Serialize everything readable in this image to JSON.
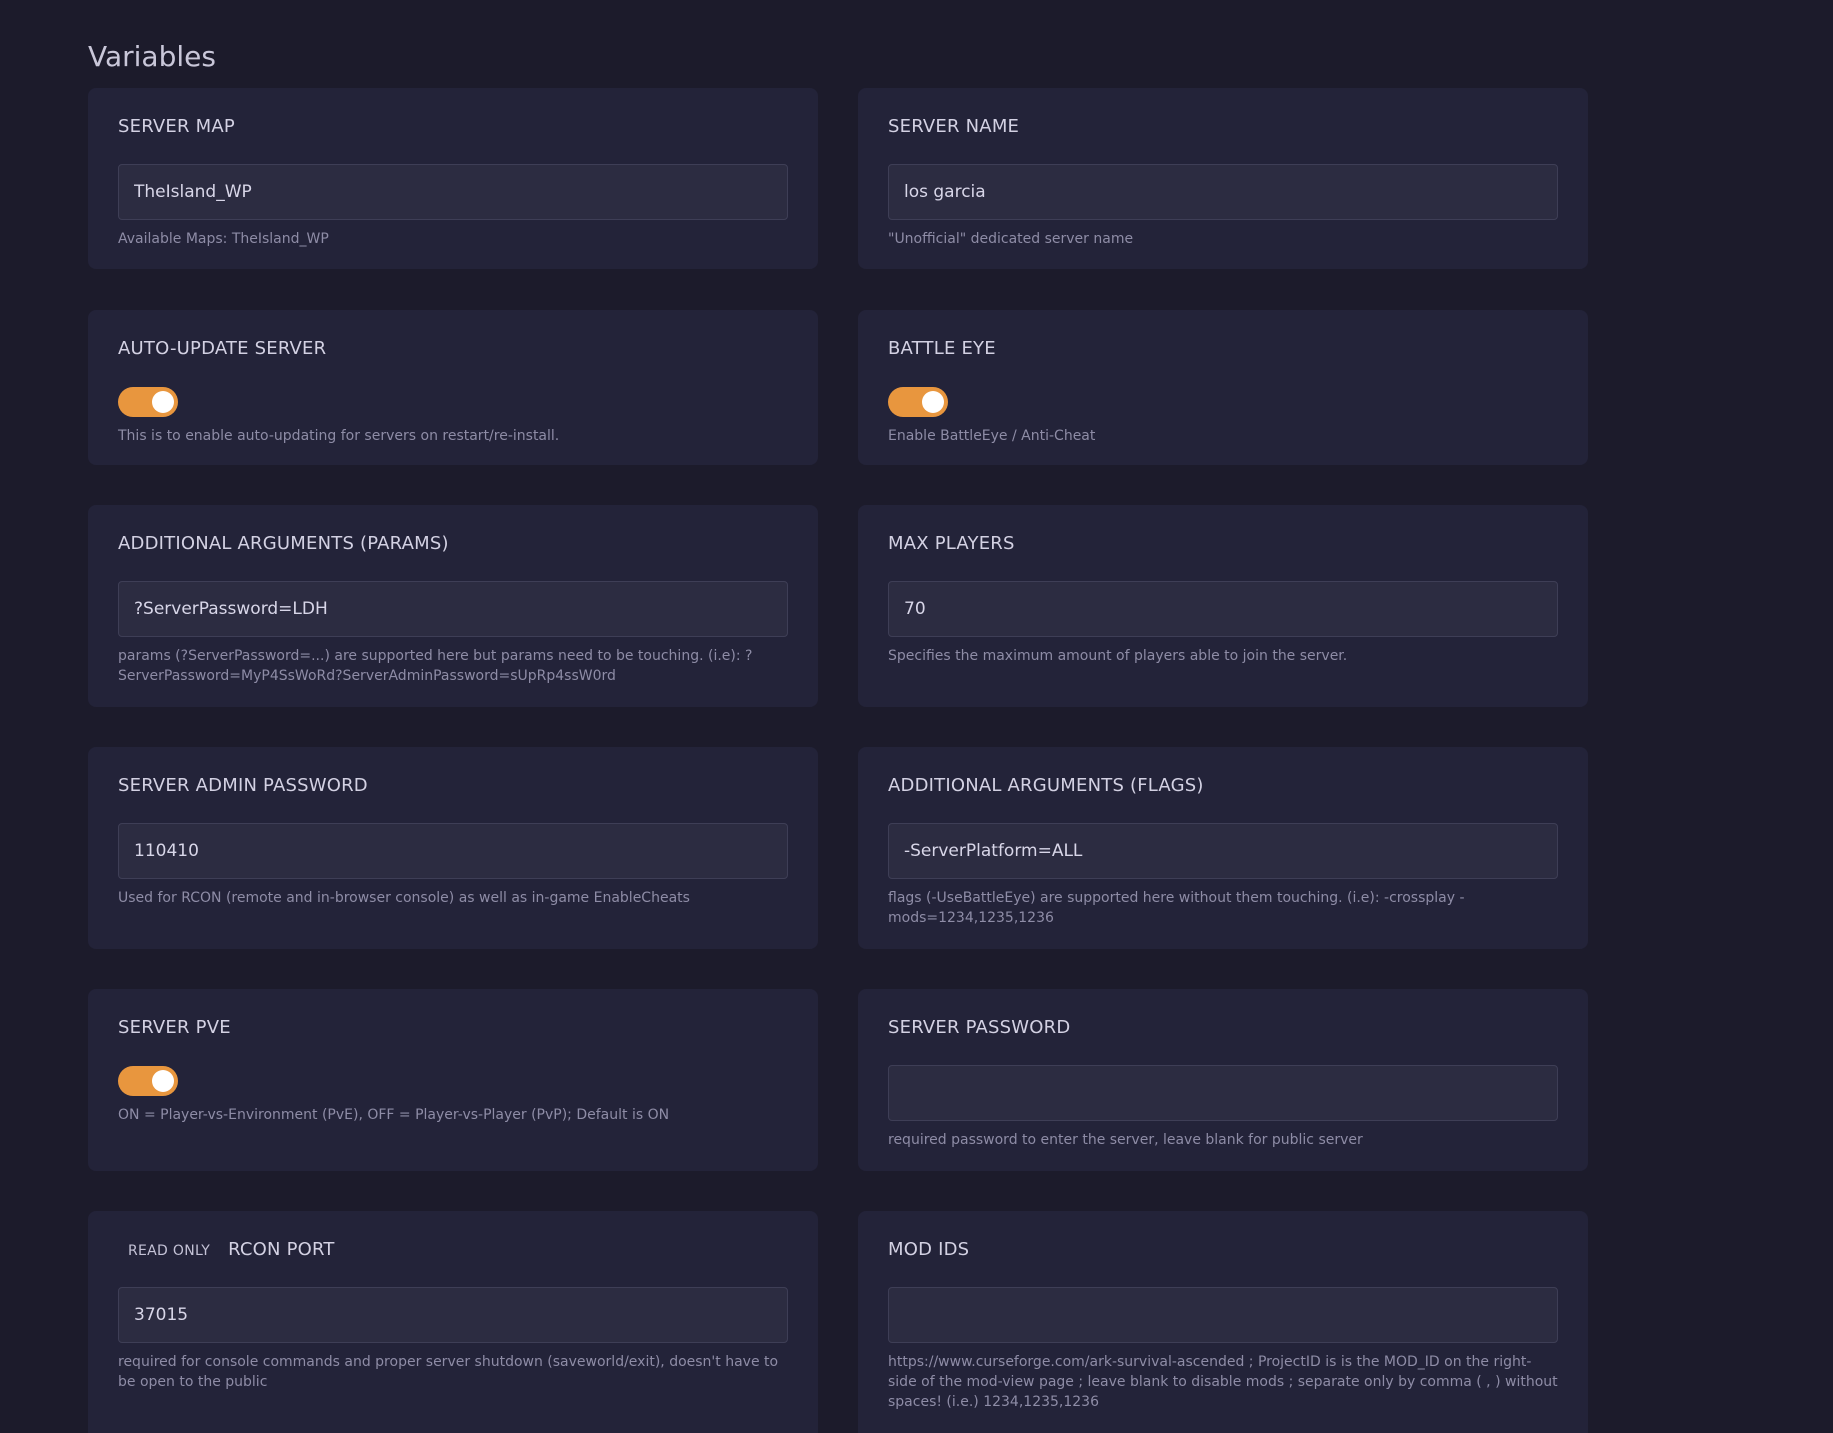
{
  "page": {
    "title": "Variables"
  },
  "colors": {
    "background": "#1c1b2b",
    "card": "#232339",
    "input": "#2c2c41",
    "toggle_on": "#e8963e"
  },
  "cards": {
    "server_map": {
      "label": "SERVER MAP",
      "value": "TheIsland_WP",
      "help": "Available Maps: TheIsland_WP"
    },
    "server_name": {
      "label": "SERVER NAME",
      "value": "los garcia",
      "help": "\"Unofficial\" dedicated server name"
    },
    "auto_update": {
      "label": "AUTO-UPDATE SERVER",
      "enabled": true,
      "help": "This is to enable auto-updating for servers on restart/re-install."
    },
    "battle_eye": {
      "label": "BATTLE EYE",
      "enabled": true,
      "help": "Enable BattleEye / Anti-Cheat"
    },
    "additional_params": {
      "label": "ADDITIONAL ARGUMENTS (PARAMS)",
      "value": "?ServerPassword=LDH",
      "help": "params (?ServerPassword=...) are supported here but params need to be touching. (i.e): ?ServerPassword=MyP4SsWoRd?ServerAdminPassword=sUpRp4ssW0rd"
    },
    "max_players": {
      "label": "MAX PLAYERS",
      "value": "70",
      "help": "Specifies the maximum amount of players able to join the server."
    },
    "admin_password": {
      "label": "SERVER ADMIN PASSWORD",
      "value": "110410",
      "help": "Used for RCON (remote and in-browser console) as well as in-game EnableCheats"
    },
    "additional_flags": {
      "label": "ADDITIONAL ARGUMENTS (FLAGS)",
      "value": "-ServerPlatform=ALL",
      "help": "flags (-UseBattleEye) are supported here without them touching. (i.e): -crossplay -mods=1234,1235,1236"
    },
    "server_pve": {
      "label": "SERVER PVE",
      "enabled": true,
      "help": "ON = Player-vs-Environment (PvE), OFF = Player-vs-Player (PvP); Default is ON"
    },
    "server_password": {
      "label": "SERVER PASSWORD",
      "value": "",
      "help": "required password to enter the server, leave blank for public server"
    },
    "rcon_port": {
      "tag": "READ ONLY",
      "label": "RCON PORT",
      "value": "37015",
      "help": "required for console commands and proper server shutdown (saveworld/exit), doesn't have to be open to the public"
    },
    "mod_ids": {
      "label": "MOD IDS",
      "value": "",
      "help": "https://www.curseforge.com/ark-survival-ascended ; ProjectID is is the MOD_ID on the right-side of the mod-view page ; leave blank to disable mods ; separate only by comma ( , ) without spaces! (i.e.) 1234,1235,1236"
    }
  }
}
